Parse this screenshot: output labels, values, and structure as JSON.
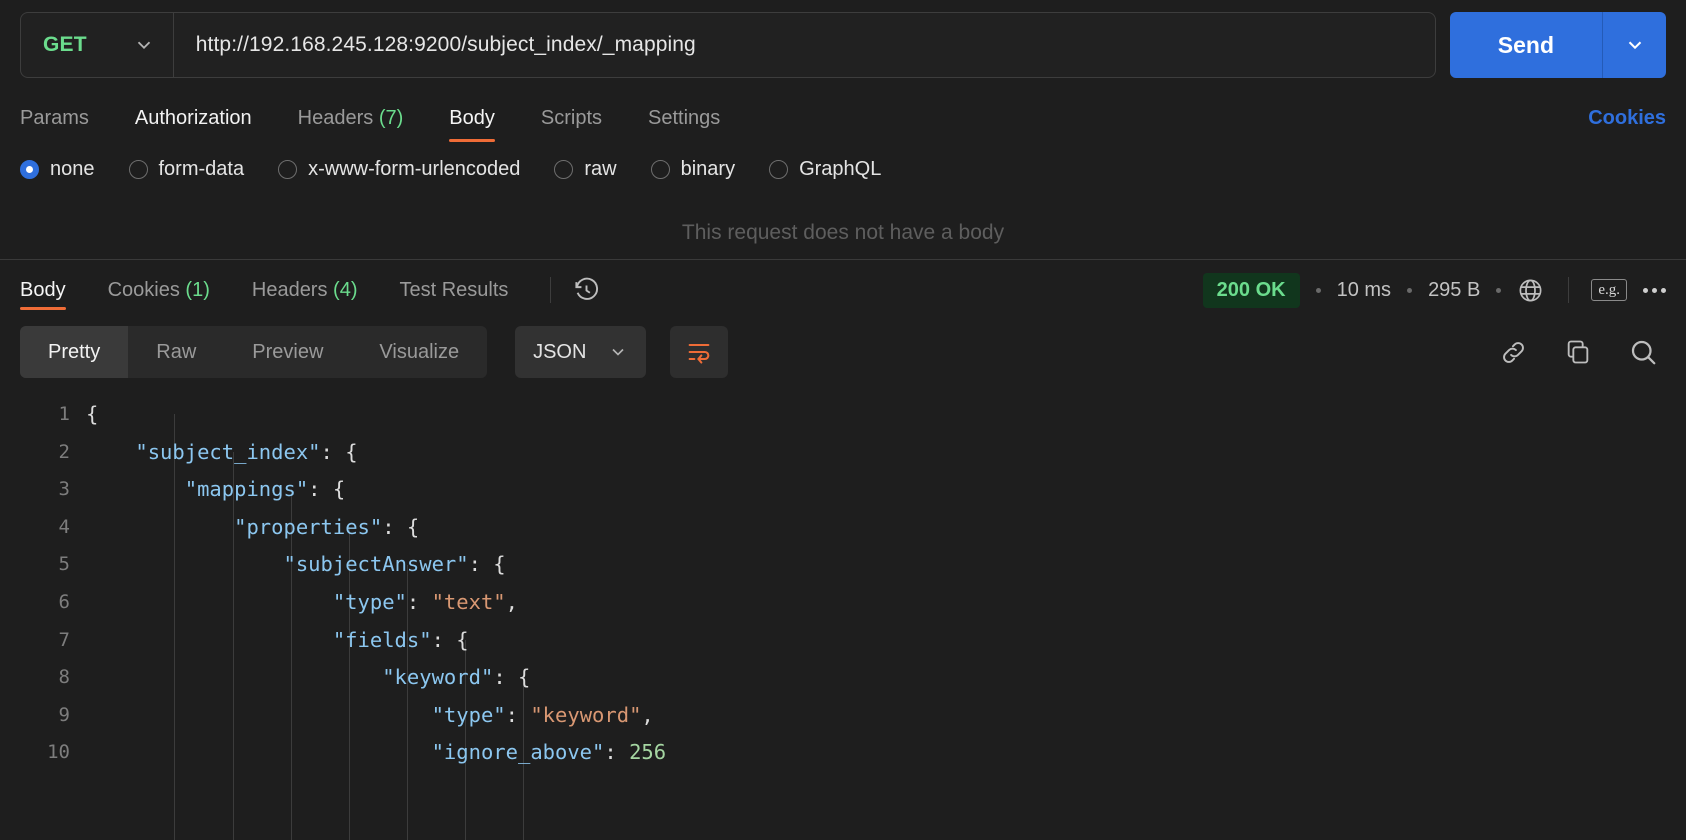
{
  "request": {
    "method": "GET",
    "url": "http://192.168.245.128:9200/subject_index/_mapping",
    "send_label": "Send",
    "tabs": [
      {
        "label": "Params",
        "count": "",
        "state": "dim"
      },
      {
        "label": "Authorization",
        "count": "",
        "state": "strong"
      },
      {
        "label": "Headers",
        "count": "(7)",
        "state": "dim"
      },
      {
        "label": "Body",
        "count": "",
        "state": "active"
      },
      {
        "label": "Scripts",
        "count": "",
        "state": "dim"
      },
      {
        "label": "Settings",
        "count": "",
        "state": "dim"
      }
    ],
    "cookies_link": "Cookies",
    "body_types": [
      {
        "label": "none",
        "selected": true
      },
      {
        "label": "form-data",
        "selected": false
      },
      {
        "label": "x-www-form-urlencoded",
        "selected": false
      },
      {
        "label": "raw",
        "selected": false
      },
      {
        "label": "binary",
        "selected": false
      },
      {
        "label": "GraphQL",
        "selected": false
      }
    ],
    "empty_body_message": "This request does not have a body"
  },
  "response": {
    "tabs": [
      {
        "label": "Body",
        "count": "",
        "state": "active"
      },
      {
        "label": "Cookies",
        "count": "(1)",
        "state": "dim"
      },
      {
        "label": "Headers",
        "count": "(4)",
        "state": "dim"
      },
      {
        "label": "Test Results",
        "count": "",
        "state": "dim"
      }
    ],
    "history_icon": "history-clock-icon",
    "status": "200 OK",
    "time": "10 ms",
    "size": "295 B",
    "globe_icon": "globe-icon",
    "eg_badge": "e.g.",
    "more_icon": "more-horizontal-icon",
    "view_modes": [
      {
        "label": "Pretty",
        "active": true
      },
      {
        "label": "Raw",
        "active": false
      },
      {
        "label": "Preview",
        "active": false
      },
      {
        "label": "Visualize",
        "active": false
      }
    ],
    "language": "JSON",
    "wrap_icon": "text-wrap-icon",
    "link_icon": "link-icon",
    "copy_icon": "copy-icon",
    "search_icon": "search-icon",
    "colors": {
      "accent_orange": "#ef6c37",
      "send_blue": "#2f6fdd",
      "status_green": "#6bdc8d",
      "status_green_bg": "#11361d",
      "json_key": "#8cc7f0",
      "json_string": "#d99873",
      "json_number": "#a5d6a2"
    },
    "code_lines": [
      {
        "num": "1",
        "indent": 0,
        "tokens": [
          {
            "t": "{",
            "c": "p"
          }
        ]
      },
      {
        "num": "2",
        "indent": 1,
        "tokens": [
          {
            "t": "\"subject_index\"",
            "c": "k"
          },
          {
            "t": ": {",
            "c": "p"
          }
        ]
      },
      {
        "num": "3",
        "indent": 2,
        "tokens": [
          {
            "t": "\"mappings\"",
            "c": "k"
          },
          {
            "t": ": {",
            "c": "p"
          }
        ]
      },
      {
        "num": "4",
        "indent": 3,
        "tokens": [
          {
            "t": "\"properties\"",
            "c": "k"
          },
          {
            "t": ": {",
            "c": "p"
          }
        ]
      },
      {
        "num": "5",
        "indent": 4,
        "tokens": [
          {
            "t": "\"subjectAnswer\"",
            "c": "k"
          },
          {
            "t": ": {",
            "c": "p"
          }
        ]
      },
      {
        "num": "6",
        "indent": 5,
        "tokens": [
          {
            "t": "\"type\"",
            "c": "k"
          },
          {
            "t": ": ",
            "c": "p"
          },
          {
            "t": "\"text\"",
            "c": "s"
          },
          {
            "t": ",",
            "c": "p"
          }
        ]
      },
      {
        "num": "7",
        "indent": 5,
        "tokens": [
          {
            "t": "\"fields\"",
            "c": "k"
          },
          {
            "t": ": {",
            "c": "p"
          }
        ]
      },
      {
        "num": "8",
        "indent": 6,
        "tokens": [
          {
            "t": "\"keyword\"",
            "c": "k"
          },
          {
            "t": ": {",
            "c": "p"
          }
        ]
      },
      {
        "num": "9",
        "indent": 7,
        "tokens": [
          {
            "t": "\"type\"",
            "c": "k"
          },
          {
            "t": ": ",
            "c": "p"
          },
          {
            "t": "\"keyword\"",
            "c": "s"
          },
          {
            "t": ",",
            "c": "p"
          }
        ]
      },
      {
        "num": "10",
        "indent": 7,
        "tokens": [
          {
            "t": "\"ignore_above\"",
            "c": "k"
          },
          {
            "t": ": ",
            "c": "p"
          },
          {
            "t": "256",
            "c": "n"
          }
        ]
      }
    ]
  }
}
